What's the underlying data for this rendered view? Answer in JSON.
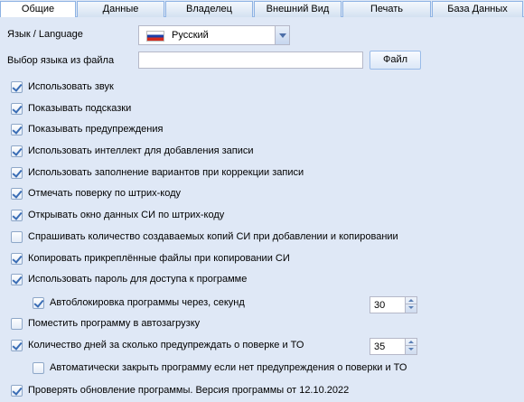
{
  "tabs": [
    {
      "label": "Общие",
      "active": true
    },
    {
      "label": "Данные",
      "active": false
    },
    {
      "label": "Владелец",
      "active": false
    },
    {
      "label": "Внешний Вид",
      "active": false
    },
    {
      "label": "Печать",
      "active": false
    },
    {
      "label": "База Данных",
      "active": false
    }
  ],
  "language": {
    "label": "Язык / Language",
    "selected": "Русский",
    "flag_icon": "russia-flag-icon"
  },
  "language_file": {
    "label": "Выбор языка из файла",
    "value": "",
    "button_label": "Файл"
  },
  "options": [
    {
      "label": "Использовать звук",
      "checked": true
    },
    {
      "label": "Показывать подсказки",
      "checked": true
    },
    {
      "label": "Показывать предупреждения",
      "checked": true
    },
    {
      "label": "Использовать интеллект для добавления записи",
      "checked": true
    },
    {
      "label": "Использовать заполнение вариантов при коррекции записи",
      "checked": true
    },
    {
      "label": "Отмечать поверку по штрих-коду",
      "checked": true
    },
    {
      "label": "Открывать окно данных СИ по штрих-коду",
      "checked": true
    },
    {
      "label": "Спрашивать количество создаваемых копий СИ при добавлении и копировании",
      "checked": false
    },
    {
      "label": "Копировать прикреплённые файлы при копировании СИ",
      "checked": true
    },
    {
      "label": "Использовать пароль для доступа к программе",
      "checked": true
    },
    {
      "label": "Автоблокировка программы через, секунд",
      "checked": true,
      "value": "30"
    },
    {
      "label": "Поместить программу в автозагрузку",
      "checked": false
    },
    {
      "label": "Количество дней за сколько предупреждать о поверке и ТО",
      "checked": true,
      "value": "35"
    },
    {
      "label": "Автоматически закрыть программу если нет предупреждения о поверки и ТО",
      "checked": false
    },
    {
      "label": "Проверять обновление программы. Версия программы от 12.10.2022",
      "checked": true
    }
  ]
}
